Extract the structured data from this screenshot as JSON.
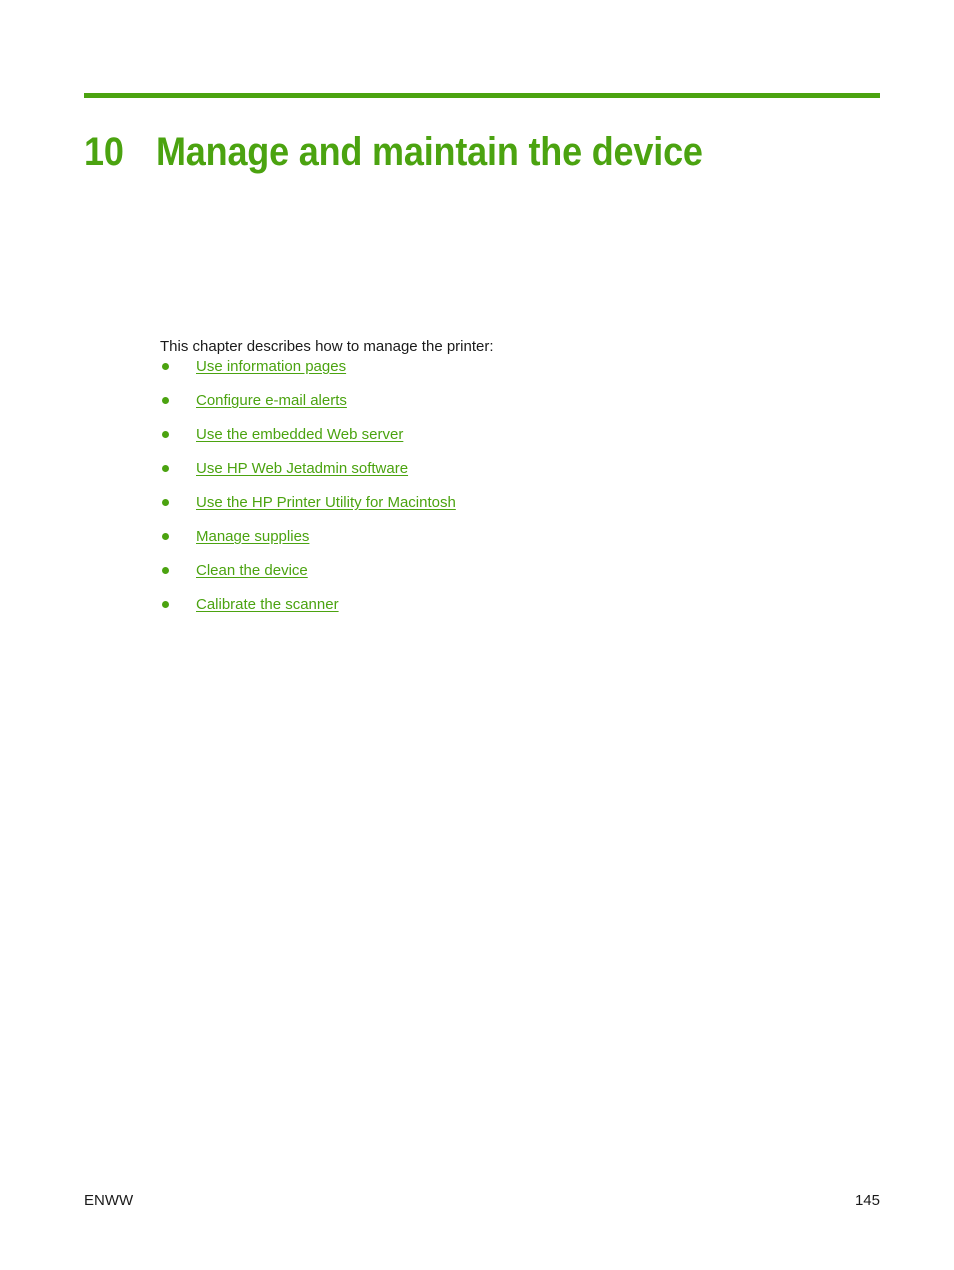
{
  "document": {
    "chapter_number": "10",
    "chapter_title": "Manage and maintain the device",
    "intro": "This chapter describes how to manage the printer:",
    "accent_color": "#4ba310",
    "text_color": "#1a1a1a",
    "background_color": "#ffffff"
  },
  "links": [
    {
      "label": "Use information pages"
    },
    {
      "label": "Configure e-mail alerts"
    },
    {
      "label": "Use the embedded Web server"
    },
    {
      "label": "Use HP Web Jetadmin software"
    },
    {
      "label": "Use the HP Printer Utility for Macintosh"
    },
    {
      "label": "Manage supplies"
    },
    {
      "label": "Clean the device"
    },
    {
      "label": "Calibrate the scanner"
    }
  ],
  "footer": {
    "locale": "ENWW",
    "page_number": "145"
  }
}
